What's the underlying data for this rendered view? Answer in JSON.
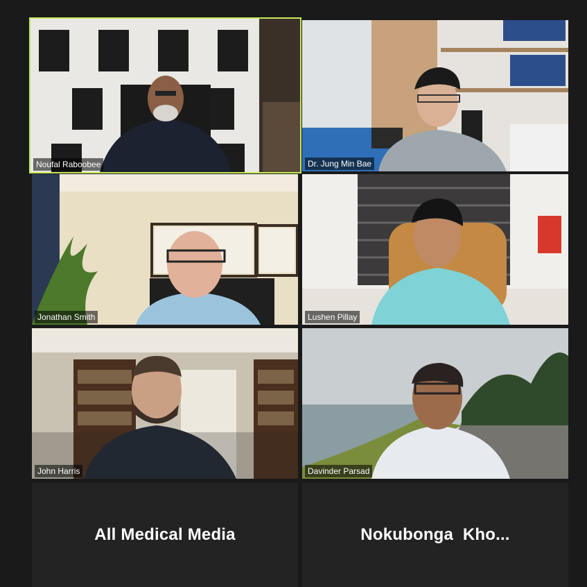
{
  "participants": [
    {
      "name": "Noufal Raboobee",
      "video": true,
      "active": true
    },
    {
      "name": "Dr. Jung Min Bae",
      "video": true
    },
    {
      "name": "Jonathan Smith",
      "video": true
    },
    {
      "name": "Lushen Pillay",
      "video": true
    },
    {
      "name": "John Harris",
      "video": true
    },
    {
      "name": "Davinder Parsad",
      "video": true
    },
    {
      "name": "All Medical Media",
      "video": false
    },
    {
      "name": "Nokubonga  Kho...",
      "video": false
    }
  ],
  "colors": {
    "background": "#1a1a1a",
    "active_speaker_border": "#c6e85a",
    "tile_background": "#232323"
  }
}
